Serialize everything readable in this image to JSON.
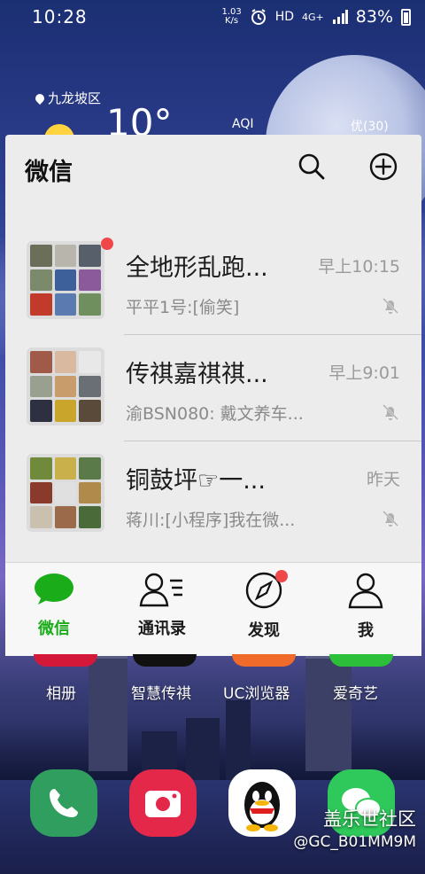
{
  "status_bar": {
    "time": "10:28",
    "speed_value": "1.03",
    "speed_unit": "K/s",
    "network": "HD",
    "signal_type": "4G+",
    "battery": "83%"
  },
  "weather": {
    "location": "九龙坡区",
    "temperature": "10°",
    "aqi_label": "AQI",
    "aqi_value": "优(30)"
  },
  "wechat_widget": {
    "title": "微信",
    "chats": [
      {
        "name": "全地形乱跑...",
        "time": "早上10:15",
        "message": "平平1号:[偷笑]",
        "unread": true,
        "tiles": [
          "#6b6f5a",
          "#b8b5ad",
          "#57606a",
          "#7a8a6a",
          "#3d5f9a",
          "#8b5a9b",
          "#c23a2a",
          "#5a7ab0",
          "#6f8f5e"
        ]
      },
      {
        "name": "传祺嘉祺祺...",
        "time": "早上9:01",
        "message": "渝BSN080: 戴文养车...",
        "unread": false,
        "tiles": [
          "#a05a48",
          "#d9b9a0",
          "#e8e8e8",
          "#9aa08f",
          "#c99d6b",
          "#6a6f75",
          "#2d3040",
          "#c9a62b",
          "#5a4a3a"
        ]
      },
      {
        "name": "铜鼓坪☞一...",
        "time": "昨天",
        "message": "蒋川:[小程序]我在微...",
        "unread": false,
        "tiles": [
          "#6f8a3a",
          "#c9b04a",
          "#5a7a4a",
          "#8a3a2a",
          "#e0e0e0",
          "#b08a4a",
          "#c9c0b0",
          "#9a6a4a",
          "#4a6a3a"
        ]
      }
    ],
    "tabs": [
      {
        "label": "微信",
        "active": true
      },
      {
        "label": "通讯录",
        "active": false
      },
      {
        "label": "发现",
        "active": false,
        "badge": true
      },
      {
        "label": "我",
        "active": false
      }
    ]
  },
  "home_apps": [
    {
      "label": "相册",
      "color": "#d3183a"
    },
    {
      "label": "智慧传祺",
      "color": "#111111"
    },
    {
      "label": "UC浏览器",
      "color": "#f06a2a"
    },
    {
      "label": "爱奇艺",
      "color": "#2bbf3a"
    }
  ],
  "dock": [
    {
      "name": "phone",
      "color": "#2f9e5e"
    },
    {
      "name": "camera",
      "color": "#e3284a"
    },
    {
      "name": "qq",
      "color": "#ffffff"
    },
    {
      "name": "wechat",
      "color": "#2ec95a"
    }
  ],
  "watermark": {
    "line1": "盖乐世社区",
    "line2": "@GC_B01MM9M"
  }
}
